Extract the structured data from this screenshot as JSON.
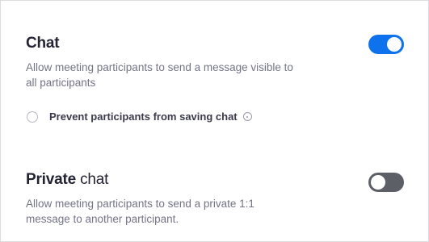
{
  "chat": {
    "title": "Chat",
    "description_line1": "Allow meeting participants to send a message visible to",
    "description_line2": "all participants",
    "enabled": true,
    "option_label": "Prevent participants from saving chat",
    "option_checked": false
  },
  "private_chat": {
    "title_bold": "Private",
    "title_rest": " chat",
    "description_line1": "Allow meeting participants to send a private 1:1",
    "description_line2": "message to another participant.",
    "enabled": false
  },
  "colors": {
    "toggle_on": "#0e72ed",
    "toggle_off": "#5c5f66"
  },
  "icons": {
    "info": "info-icon"
  }
}
